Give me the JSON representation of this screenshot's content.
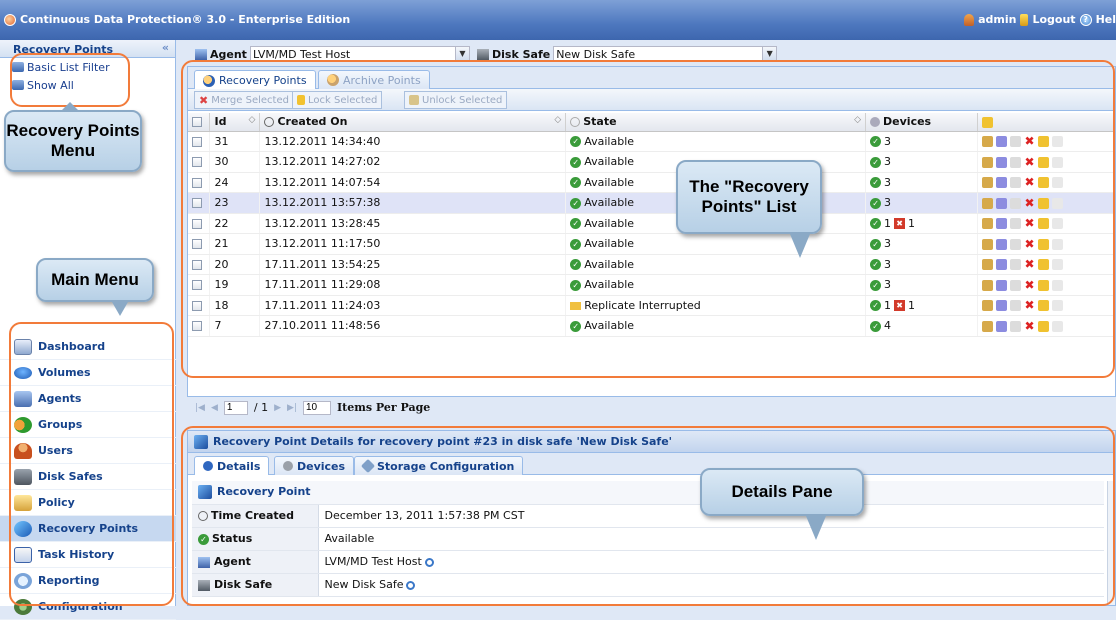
{
  "app": {
    "title": "Continuous Data Protection® 3.0 - Enterprise Edition",
    "user": "admin",
    "logout": "Logout",
    "help": "Hel"
  },
  "sidebar": {
    "recovery_points_title": "Recovery Points",
    "collapse_glyph": "«",
    "links": [
      "Basic List Filter",
      "Show All"
    ],
    "main_menu": [
      "Dashboard",
      "Volumes",
      "Agents",
      "Groups",
      "Users",
      "Disk Safes",
      "Policy",
      "Recovery Points",
      "Task History",
      "Reporting",
      "Configuration"
    ],
    "active_item": "Recovery Points"
  },
  "filters": {
    "agent_label": "Agent",
    "agent_value": "LVM/MD Test Host",
    "disk_safe_label": "Disk Safe",
    "disk_safe_value": "New Disk Safe"
  },
  "recovery_tabs": [
    "Recovery Points",
    "Archive Points"
  ],
  "toolbar": {
    "merge": "Merge Selected",
    "lock": "Lock Selected",
    "unlock": "Unlock Selected"
  },
  "grid": {
    "columns": [
      "Id",
      "Created On",
      "State",
      "Devices"
    ],
    "rows": [
      {
        "id": "31",
        "created": "13.12.2011 14:34:40",
        "state": "Available",
        "ok": "3",
        "err": ""
      },
      {
        "id": "30",
        "created": "13.12.2011 14:27:02",
        "state": "Available",
        "ok": "3",
        "err": ""
      },
      {
        "id": "24",
        "created": "13.12.2011 14:07:54",
        "state": "Available",
        "ok": "3",
        "err": ""
      },
      {
        "id": "23",
        "created": "13.12.2011 13:57:38",
        "state": "Available",
        "ok": "3",
        "err": ""
      },
      {
        "id": "22",
        "created": "13.12.2011 13:28:45",
        "state": "Available",
        "ok": "1",
        "err": "1"
      },
      {
        "id": "21",
        "created": "13.12.2011 11:17:50",
        "state": "Available",
        "ok": "3",
        "err": ""
      },
      {
        "id": "20",
        "created": "17.11.2011 13:54:25",
        "state": "Available",
        "ok": "3",
        "err": ""
      },
      {
        "id": "19",
        "created": "17.11.2011 11:29:08",
        "state": "Available",
        "ok": "3",
        "err": ""
      },
      {
        "id": "18",
        "created": "17.11.2011 11:24:03",
        "state": "Replicate Interrupted",
        "ok": "1",
        "err": "1"
      },
      {
        "id": "7",
        "created": "27.10.2011 11:48:56",
        "state": "Available",
        "ok": "4",
        "err": ""
      }
    ],
    "selected_index": 3
  },
  "pager": {
    "page": "1",
    "of": "/ 1",
    "per_page": "10",
    "per_page_label": "Items Per Page"
  },
  "details": {
    "title": "Recovery Point Details for recovery point #23 in disk safe 'New Disk Safe'",
    "tabs": [
      "Details",
      "Devices",
      "Storage Configuration"
    ],
    "section": "Recovery Point",
    "fields": [
      {
        "key": "Time Created",
        "value": "December 13, 2011 1:57:38 PM CST"
      },
      {
        "key": "Status",
        "value": "Available"
      },
      {
        "key": "Agent",
        "value": "LVM/MD Test Host"
      },
      {
        "key": "Disk Safe",
        "value": "New Disk Safe"
      }
    ]
  },
  "callouts": {
    "recovery_points_menu": "Recovery Points Menu",
    "main_menu": "Main Menu",
    "recovery_points_list": "The \"Recovery Points\" List",
    "details_pane": "Details Pane"
  },
  "colors": {
    "highlight": "#f27b3a",
    "header": "#4e78bf",
    "panel_border": "#99bbe8"
  }
}
